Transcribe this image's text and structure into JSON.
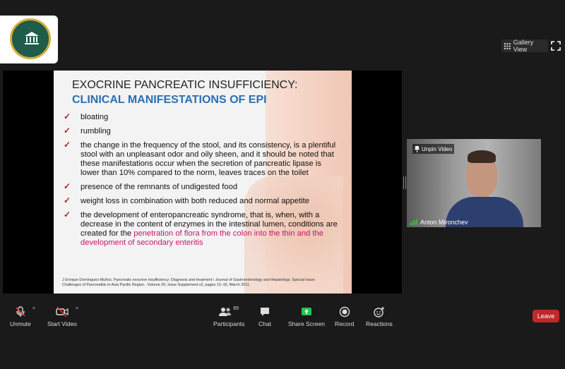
{
  "header": {
    "gallery_label": "Gallery View"
  },
  "slide": {
    "title_line1": "EXOCRINE PANCREATIC INSUFFICIENCY:",
    "title_line2": "CLINICAL MANIFESTATIONS OF EPI",
    "bullets": [
      {
        "text": "bloating"
      },
      {
        "text": "rumbling"
      },
      {
        "text": "the change in the frequency of the stool, and its consistency, is a plentiful stool with an unpleasant odor and oily sheen, and it should be noted that these manifestations occur when the secretion of pancreatic lipase is lower than 10% compared to the norm, leaves traces on the toilet"
      },
      {
        "text": "presence of the remnants of undigested food"
      },
      {
        "text": "weight loss in combination with both reduced and normal appetite"
      },
      {
        "text": "the development of enteropancreatic syndrome, that is, when, with a decrease in the content of enzymes in the intestinal lumen, conditions are created for the ",
        "highlight": "penetration of flora from the colon into the thin and the development of secondary enteritis"
      }
    ],
    "citation_line1": "J Enrique Domínguez-Muñoz.  Pancreatic exocrine insufficiency: Diagnosis and treatment / Journal of Gastroenterology and Hepatology. Special Issue:",
    "citation_line2": "Challenges of Pancreatitis in Asia Pacific Region. -Volume 26, Issue Supplement s2, pages 12–16, March 2011"
  },
  "participant_video": {
    "unpin_label": "Unpin Video",
    "name": "Anton Mironchev"
  },
  "toolbar": {
    "unmute": "Unmute",
    "start_video": "Start Video",
    "participants": "Participants",
    "participants_count": "65",
    "chat": "Chat",
    "share_screen": "Share Screen",
    "record": "Record",
    "reactions": "Reactions",
    "leave": "Leave"
  },
  "colors": {
    "leave_red": "#c0282a",
    "share_green": "#23c552",
    "title_blue": "#2a6fb1",
    "highlight_pink": "#c2186b",
    "check_red": "#b0201c"
  }
}
